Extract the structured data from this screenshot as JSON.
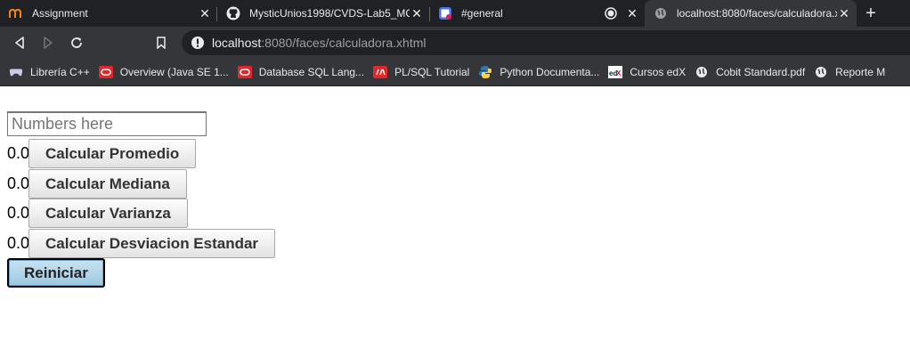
{
  "browser": {
    "tabs": [
      {
        "title": "Assignment"
      },
      {
        "title": "MysticUnios1998/CVDS-Lab5_MC\\"
      },
      {
        "title": "#general"
      },
      {
        "title": "localhost:8080/faces/calculadora.xh"
      }
    ],
    "address": {
      "host": "localhost",
      "rest": ":8080/faces/calculadora.xhtml"
    },
    "bookmarks": [
      {
        "label": "Librería C++"
      },
      {
        "label": "Overview (Java SE 1..."
      },
      {
        "label": "Database SQL Lang..."
      },
      {
        "label": "PL/SQL Tutorial"
      },
      {
        "label": "Python Documenta..."
      },
      {
        "label": "Cursos edX"
      },
      {
        "label": "Cobit Standard.pdf"
      },
      {
        "label": "Reporte M"
      }
    ]
  },
  "form": {
    "numbers_placeholder": "Numbers here",
    "promedio": {
      "value": "0.0",
      "button": "Calcular Promedio"
    },
    "mediana": {
      "value": "0.0",
      "button": "Calcular Mediana"
    },
    "varianza": {
      "value": "0.0",
      "button": "Calcular Varianza"
    },
    "desviacion": {
      "value": "0.0",
      "button": "Calcular Desviacion Estandar"
    },
    "reset_button": "Reiniciar"
  }
}
